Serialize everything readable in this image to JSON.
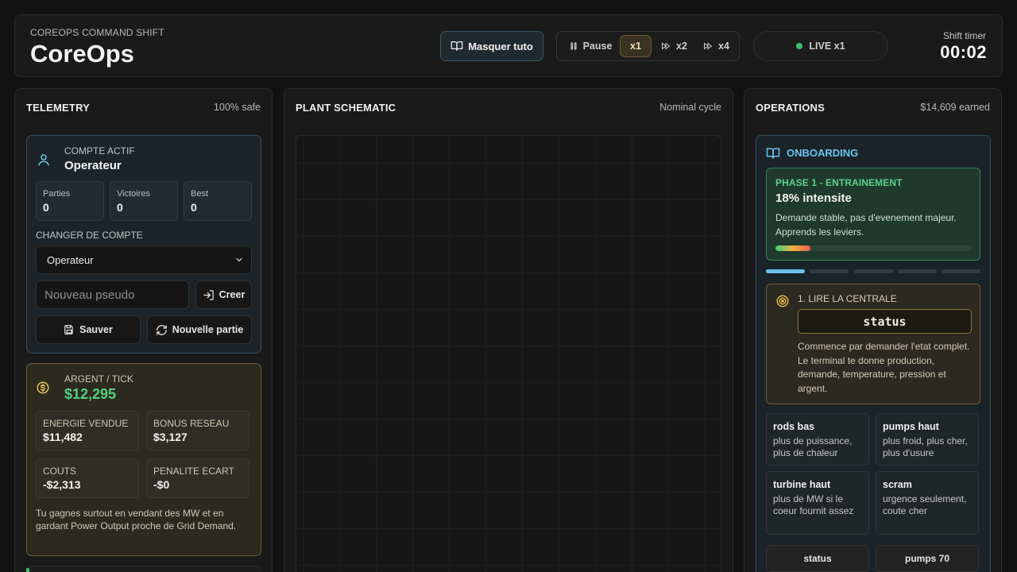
{
  "header": {
    "subtitle": "COREOPS COMMAND SHIFT",
    "title": "CoreOps",
    "tuto_button": "Masquer tuto",
    "speed": {
      "pause": "Pause",
      "x1": "x1",
      "x2": "x2",
      "x4": "x4",
      "selected": "x1"
    },
    "live_status": "LIVE x1",
    "timer_label": "Shift timer",
    "timer_value": "00:02"
  },
  "telemetry": {
    "title": "TELEMETRY",
    "meta": "100% safe",
    "account": {
      "label": "COMPTE ACTIF",
      "name": "Operateur",
      "stats": [
        {
          "label": "Parties",
          "value": "0"
        },
        {
          "label": "Victoires",
          "value": "0"
        },
        {
          "label": "Best",
          "value": "0"
        }
      ],
      "switch_label": "CHANGER DE COMPTE",
      "selected_account": "Operateur",
      "pseudo_placeholder": "Nouveau pseudo",
      "create_button": "Creer",
      "save_button": "Sauver",
      "new_game_button": "Nouvelle partie"
    },
    "money": {
      "label": "ARGENT / TICK",
      "value": "$12,295",
      "boxes": [
        {
          "label": "ENERGIE VENDUE",
          "value": "$11,482"
        },
        {
          "label": "BONUS RESEAU",
          "value": "$3,127"
        },
        {
          "label": "COUTS",
          "value": "-$2,313"
        },
        {
          "label": "PENALITE ECART",
          "value": "-$0"
        }
      ],
      "note": "Tu gagnes surtout en vendant des MW et en gardant Power Output proche de Grid Demand."
    }
  },
  "schematic": {
    "title": "PLANT SCHEMATIC",
    "meta": "Nominal cycle"
  },
  "operations": {
    "title": "OPERATIONS",
    "meta": "$14,609 earned",
    "onboarding": {
      "title": "ONBOARDING",
      "phase": {
        "tag": "PHASE 1 - ENTRAINEMENT",
        "intensity": "18% intensite",
        "intensity_fraction": 0.18,
        "description": "Demande stable, pas d'evenement majeur. Apprends les leviers."
      },
      "steps_total": 5,
      "steps_active": 1,
      "task": {
        "label": "1. LIRE LA CENTRALE",
        "command": "status",
        "description": "Commence par demander l'etat complet. Le terminal te donne production, demande, temperature, pression et argent."
      },
      "tips": [
        {
          "title": "rods bas",
          "desc": "plus de puissance, plus de chaleur"
        },
        {
          "title": "pumps haut",
          "desc": "plus froid, plus cher, plus d'usure"
        },
        {
          "title": "turbine haut",
          "desc": "plus de MW si le coeur fournit assez"
        },
        {
          "title": "scram",
          "desc": "urgence seulement, coute cher"
        }
      ],
      "quick_commands": [
        "status",
        "pumps 70"
      ]
    }
  },
  "colors": {
    "accent_blue": "#6cc6f1",
    "money_green": "#55cf83",
    "phase_green": "#5cd08c",
    "live_dot": "#3ac46a",
    "gold_border": "#6c5f34"
  },
  "icons": {
    "tuto": "book-icon",
    "pause": "pause-icon",
    "fast_forward": "fast-forward-icon",
    "account": "user-icon",
    "money": "coin-icon",
    "create": "login-icon",
    "save": "save-icon",
    "new_game": "refresh-icon",
    "onboarding": "book-icon",
    "task": "target-icon",
    "select": "chevron-down-icon"
  }
}
